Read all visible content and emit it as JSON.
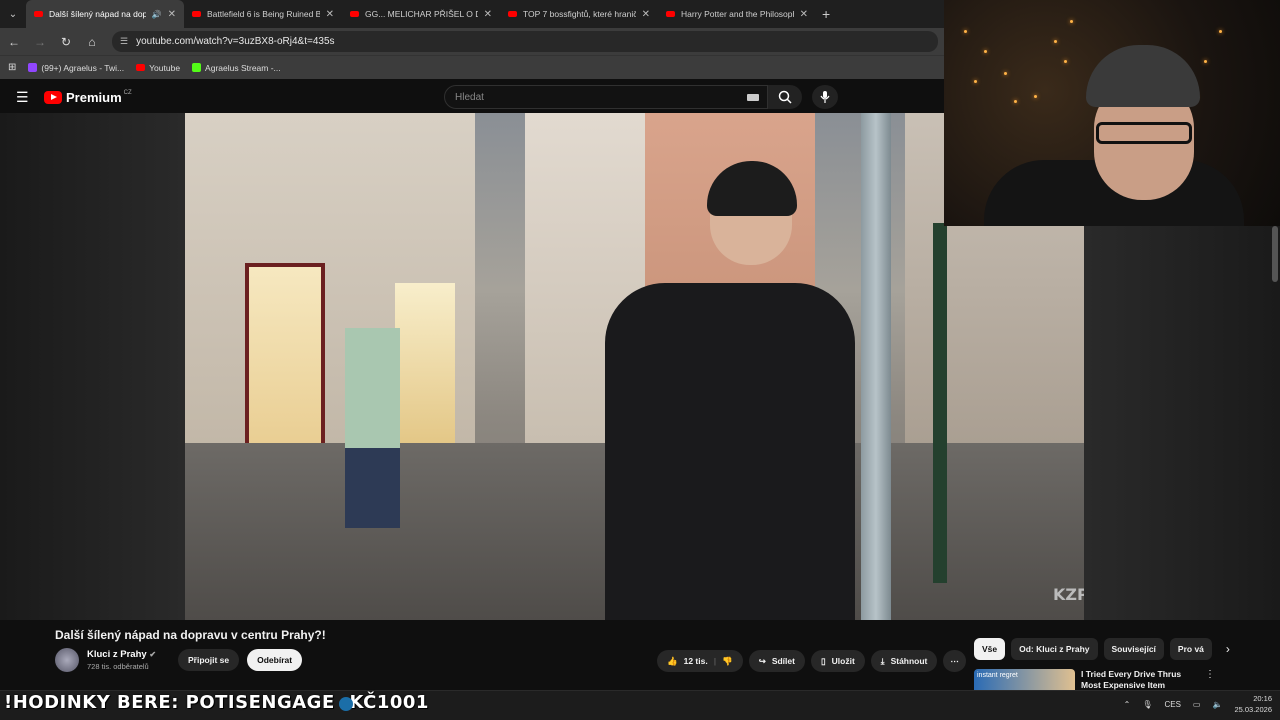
{
  "browser": {
    "tabs": [
      {
        "title": "Další šílený nápad na dopr...",
        "active": true
      },
      {
        "title": "Battlefield 6 is Being Ruined By",
        "active": false
      },
      {
        "title": "GG... MELICHAR PŘIŠEL O DALŠ",
        "active": false
      },
      {
        "title": "TOP 7 bossfightů, které hraničí",
        "active": false
      },
      {
        "title": "Harry Potter and the Philosoph",
        "active": false
      }
    ],
    "url": "youtube.com/watch?v=3uzBX8-oRj4&t=435s",
    "bookmarks": [
      "(99+) Agraelus - Twi...",
      "Youtube",
      "Agraelus Stream -..."
    ]
  },
  "youtube": {
    "logo": "Premium",
    "logo_country": "CZ",
    "search_placeholder": "Hledat",
    "video_title": "Další šílený nápad na dopravu v centru Prahy?!",
    "channel_name": "Kluci z Prahy",
    "channel_subs": "728 tis. odběratelů",
    "join_label": "Připojit se",
    "subscribe_label": "Odebírat",
    "likes": "12 tis.",
    "share_label": "Sdílet",
    "save_label": "Uložit",
    "download_label": "Stáhnout",
    "watermark": "KZP",
    "chips": [
      "Vše",
      "Od: Kluci z Prahy",
      "Související",
      "Pro vá"
    ],
    "recommendation": {
      "thumb_text": "instant regret",
      "title": "I Tried Every Drive Thrus Most Expensive Item"
    }
  },
  "stream_overlay": {
    "ticker": "!HODINKY BERE: POTISENGAGE -KČ1001"
  },
  "taskbar": {
    "language": "CES",
    "time": "20:16",
    "date": "25.03.2026"
  }
}
